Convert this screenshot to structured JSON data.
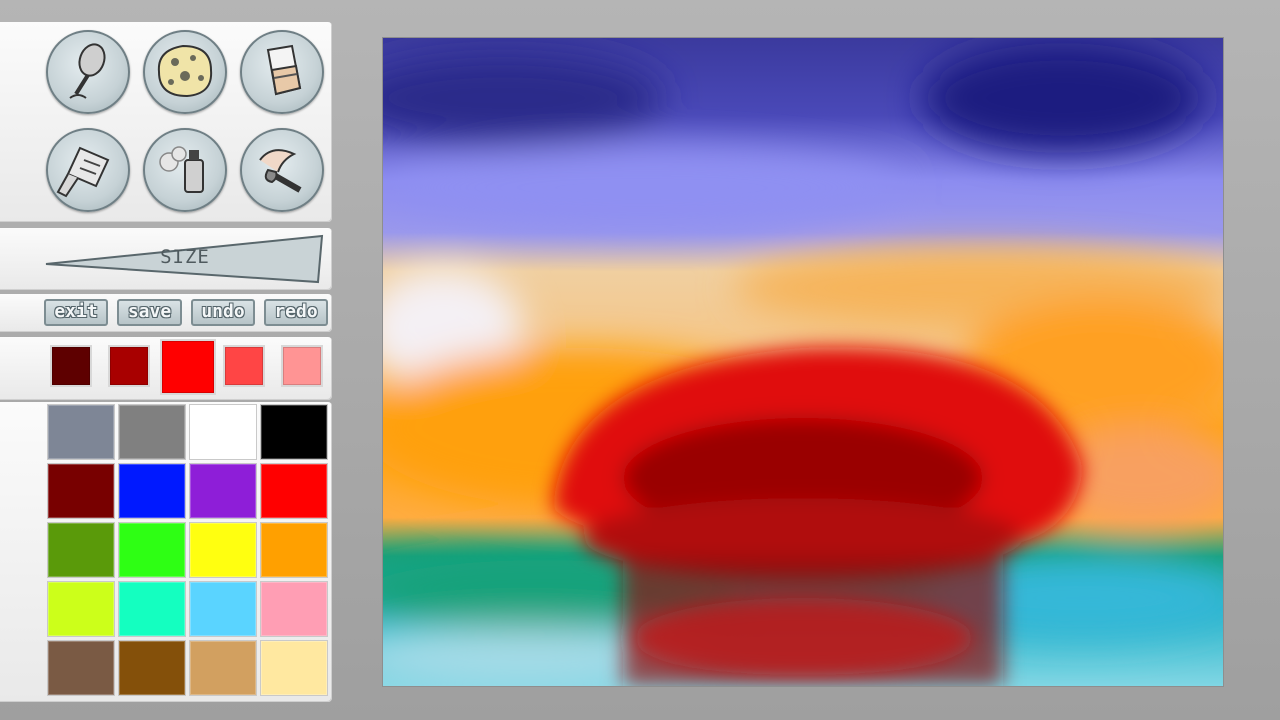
{
  "tools": [
    {
      "name": "microphone-tool-icon"
    },
    {
      "name": "sponge-tool-icon"
    },
    {
      "name": "eraser-tool-icon"
    },
    {
      "name": "glue-tool-icon"
    },
    {
      "name": "spray-can-tool-icon"
    },
    {
      "name": "paintbrush-tool-icon"
    }
  ],
  "size_slider": {
    "label": "SIZE"
  },
  "actions": {
    "exit": "exit",
    "save": "save",
    "undo": "undo",
    "redo": "redo"
  },
  "shades": {
    "colors": [
      "#5e0000",
      "#a80000",
      "#ff0000",
      "#ff4545",
      "#ff9494"
    ],
    "selected_index": 2
  },
  "palette": {
    "colors": [
      "#7e8696",
      "#808080",
      "#ffffff",
      "#000000",
      "#780000",
      "#0019ff",
      "#8e1ed8",
      "#ff0000",
      "#5a9a0a",
      "#2eff14",
      "#ffff10",
      "#ffa000",
      "#ccff1a",
      "#14ffc0",
      "#5ad4ff",
      "#ff9eb4",
      "#7a5a44",
      "#84500a",
      "#d2a060",
      "#ffe8a0"
    ]
  },
  "canvas": {
    "colors": {
      "sky_top": "#3b3aa0",
      "sky_mid": "#8f90f0",
      "cloud_light": "#f0d2a0",
      "cloud_orange": "#ffa012",
      "sun_red": "#e01010",
      "sun_dark": "#8a0000",
      "sea_green": "#12a27a",
      "sea_blue": "#3ac0e0"
    }
  }
}
